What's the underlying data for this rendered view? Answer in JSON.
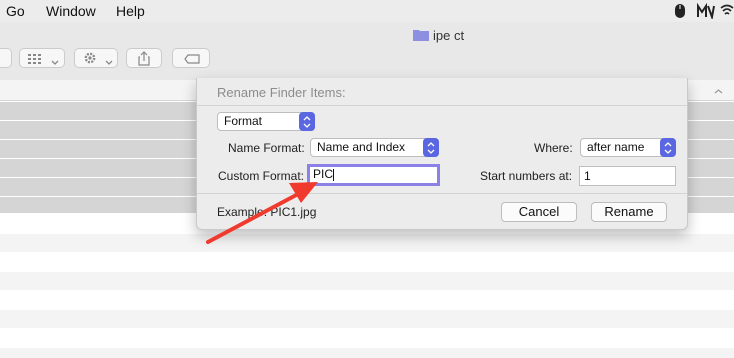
{
  "menubar": {
    "items": [
      "Go",
      "Window",
      "Help"
    ],
    "status_icons": [
      "mouse-icon",
      "app-menu-icon",
      "wifi-icon"
    ]
  },
  "window": {
    "title": "ipe ct",
    "toolbar_icons": [
      "view-grid-icon",
      "gear-icon",
      "share-icon",
      "tag-icon"
    ]
  },
  "dialog": {
    "title": "Rename Finder Items:",
    "mode_popup": "Format",
    "name_format_label": "Name Format:",
    "name_format_value": "Name and Index",
    "where_label": "Where:",
    "where_value": "after name",
    "custom_format_label": "Custom Format:",
    "custom_format_value": "PIC",
    "start_numbers_label": "Start numbers at:",
    "start_numbers_value": "1",
    "example_text": "Example: PIC1.jpg",
    "cancel_label": "Cancel",
    "rename_label": "Rename"
  },
  "annotation": {
    "arrow_color": "#f03a2e"
  },
  "colors": {
    "accent": "#5b67e0",
    "focus_ring": "#8a80e6"
  }
}
